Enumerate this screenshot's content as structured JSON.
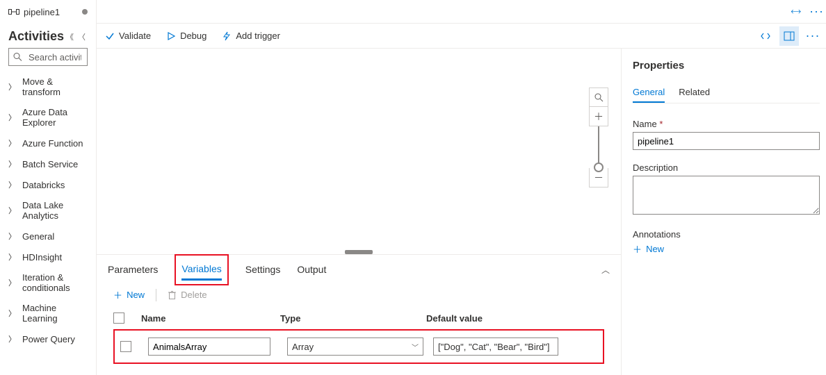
{
  "pipeline": {
    "name": "pipeline1"
  },
  "sidebar": {
    "title": "Activities",
    "searchPlaceholder": "Search activities",
    "items": [
      {
        "label": "Move & transform"
      },
      {
        "label": "Azure Data Explorer"
      },
      {
        "label": "Azure Function"
      },
      {
        "label": "Batch Service"
      },
      {
        "label": "Databricks"
      },
      {
        "label": "Data Lake Analytics"
      },
      {
        "label": "General"
      },
      {
        "label": "HDInsight"
      },
      {
        "label": "Iteration & conditionals"
      },
      {
        "label": "Machine Learning"
      },
      {
        "label": "Power Query"
      }
    ]
  },
  "toolbar": {
    "validate": "Validate",
    "debug": "Debug",
    "addTrigger": "Add trigger"
  },
  "bottomTabs": {
    "parameters": "Parameters",
    "variables": "Variables",
    "settings": "Settings",
    "output": "Output"
  },
  "varsActions": {
    "new": "New",
    "delete": "Delete"
  },
  "varsHeaders": {
    "name": "Name",
    "type": "Type",
    "default": "Default value"
  },
  "varsRows": [
    {
      "name": "AnimalsArray",
      "type": "Array",
      "default": "[\"Dog\", \"Cat\", \"Bear\", \"Bird\"]"
    }
  ],
  "properties": {
    "title": "Properties",
    "tabs": {
      "general": "General",
      "related": "Related"
    },
    "nameLabel": "Name",
    "nameValue": "pipeline1",
    "descLabel": "Description",
    "descValue": "",
    "annotLabel": "Annotations",
    "newLabel": "New"
  }
}
